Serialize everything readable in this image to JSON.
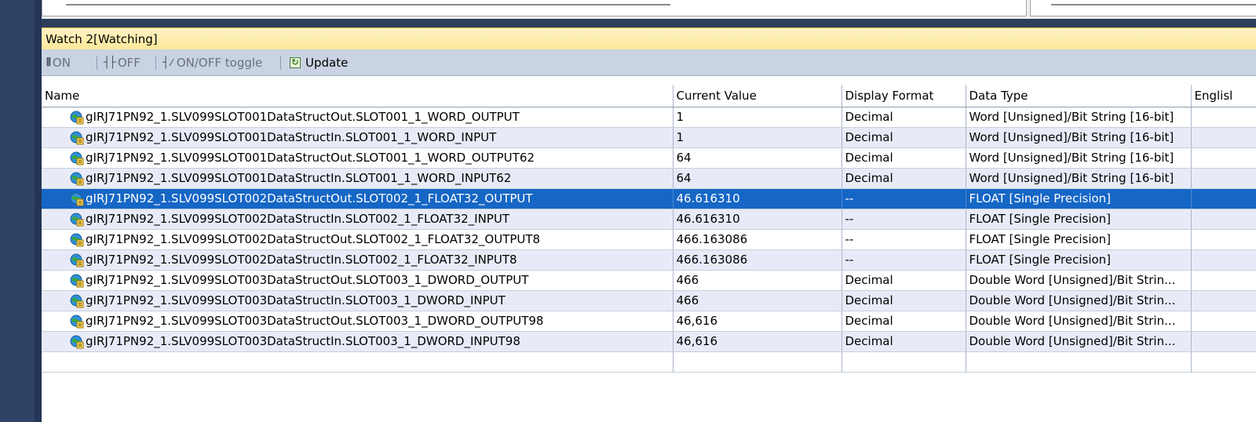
{
  "watch_window": {
    "title": "Watch 2[Watching]"
  },
  "toolbar": {
    "on_label": "ON",
    "off_label": "OFF",
    "toggle_label": "ON/OFF toggle",
    "update_label": "Update"
  },
  "columns": {
    "name": "Name",
    "current_value": "Current Value",
    "display_format": "Display Format",
    "data_type": "Data Type",
    "english": "Englisl"
  },
  "rows": [
    {
      "name": "gIRJ71PN92_1.SLV099SLOT001DataStructOut.SLOT001_1_WORD_OUTPUT",
      "value": "1",
      "format": "Decimal",
      "type": "Word [Unsigned]/Bit String [16-bit]"
    },
    {
      "name": "gIRJ71PN92_1.SLV099SLOT001DataStructIn.SLOT001_1_WORD_INPUT",
      "value": "1",
      "format": "Decimal",
      "type": "Word [Unsigned]/Bit String [16-bit]"
    },
    {
      "name": "gIRJ71PN92_1.SLV099SLOT001DataStructOut.SLOT001_1_WORD_OUTPUT62",
      "value": "64",
      "format": "Decimal",
      "type": "Word [Unsigned]/Bit String [16-bit]"
    },
    {
      "name": "gIRJ71PN92_1.SLV099SLOT001DataStructIn.SLOT001_1_WORD_INPUT62",
      "value": "64",
      "format": "Decimal",
      "type": "Word [Unsigned]/Bit String [16-bit]"
    },
    {
      "name": "gIRJ71PN92_1.SLV099SLOT002DataStructOut.SLOT002_1_FLOAT32_OUTPUT",
      "value": "46.616310",
      "format": "--",
      "type": "FLOAT [Single Precision]"
    },
    {
      "name": "gIRJ71PN92_1.SLV099SLOT002DataStructIn.SLOT002_1_FLOAT32_INPUT",
      "value": "46.616310",
      "format": "--",
      "type": "FLOAT [Single Precision]"
    },
    {
      "name": "gIRJ71PN92_1.SLV099SLOT002DataStructOut.SLOT002_1_FLOAT32_OUTPUT8",
      "value": "466.163086",
      "format": "--",
      "type": "FLOAT [Single Precision]"
    },
    {
      "name": "gIRJ71PN92_1.SLV099SLOT002DataStructIn.SLOT002_1_FLOAT32_INPUT8",
      "value": "466.163086",
      "format": "--",
      "type": "FLOAT [Single Precision]"
    },
    {
      "name": "gIRJ71PN92_1.SLV099SLOT003DataStructOut.SLOT003_1_DWORD_OUTPUT",
      "value": "466",
      "format": "Decimal",
      "type": "Double Word [Unsigned]/Bit Strin..."
    },
    {
      "name": "gIRJ71PN92_1.SLV099SLOT003DataStructIn.SLOT003_1_DWORD_INPUT",
      "value": "466",
      "format": "Decimal",
      "type": "Double Word [Unsigned]/Bit Strin..."
    },
    {
      "name": "gIRJ71PN92_1.SLV099SLOT003DataStructOut.SLOT003_1_DWORD_OUTPUT98",
      "value": "46,616",
      "format": "Decimal",
      "type": "Double Word [Unsigned]/Bit Strin..."
    },
    {
      "name": "gIRJ71PN92_1.SLV099SLOT003DataStructIn.SLOT003_1_DWORD_INPUT98",
      "value": "46,616",
      "format": "Decimal",
      "type": "Double Word [Unsigned]/Bit Strin..."
    }
  ],
  "selected_row_index": 4,
  "colors": {
    "selection": "#1666c5",
    "alt_row": "#e8ebf7",
    "title_bar": "#fde89a",
    "toolbar": "#c9d3e3"
  },
  "icons": {
    "row_icon": "global-variable-icon"
  }
}
